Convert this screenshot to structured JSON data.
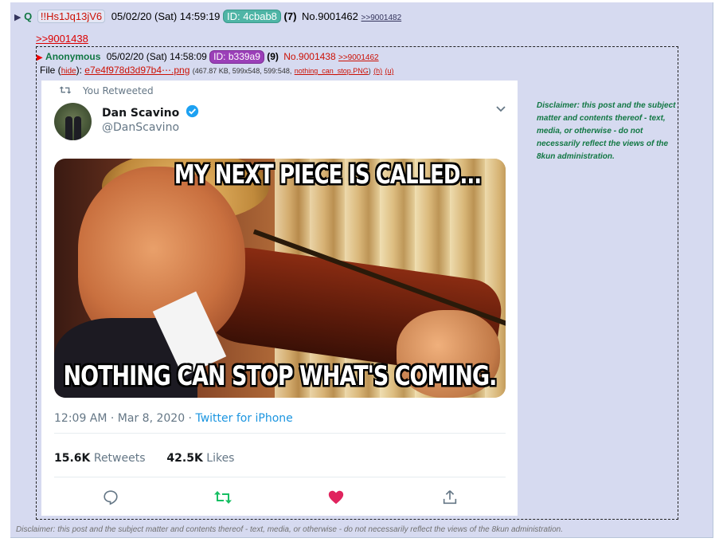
{
  "post": {
    "name": "Q",
    "tripcode": "!!Hs1Jq13jV6",
    "date": "05/02/20 (Sat) 14:59:19",
    "id_label": "ID: 4cbab8",
    "reply_count": "(7)",
    "post_number": "No.9001462",
    "backlink": ">>9001482",
    "quote_link": ">>9001438"
  },
  "quoted_post": {
    "name": "Anonymous",
    "date": "05/02/20 (Sat) 14:58:09",
    "id_label": "ID: b339a9",
    "reply_count": "(9)",
    "post_number": "No.9001438",
    "backlink": ">>9001462",
    "file_label": "File",
    "hide_link": "hide",
    "file_name": "e7e4f978d3d97b4⋯.png",
    "file_meta": "(467.87 KB, 599x548, 599:548,",
    "original_name": "nothing_can_stop.PNG",
    "h_link": "(h)",
    "u_link": "(u)",
    "file_meta_close": ")"
  },
  "tweet": {
    "retweet_label": "You Retweeted",
    "display_name": "Dan Scavino",
    "handle": "@DanScavino",
    "meme_top_text": "MY NEXT PIECE IS CALLED...",
    "meme_bottom_text": "NOTHING CAN STOP WHAT'S COMING.",
    "timestamp": "12:09 AM · Mar 8, 2020 · ",
    "source": "Twitter for iPhone",
    "retweets_count": "15.6K",
    "retweets_label": "Retweets",
    "likes_count": "42.5K",
    "likes_label": "Likes",
    "icons": [
      "retweet-icon",
      "verified-badge-icon",
      "chevron-down-icon",
      "reply-icon",
      "retweet-icon",
      "like-icon",
      "share-icon"
    ]
  },
  "disclaimer_side": "Disclaimer: this post and the subject matter and contents thereof - text, media, or otherwise - do not necessarily reflect the views of the 8kun administration.",
  "disclaimer_bottom": "Disclaimer: this post and the subject matter and contents thereof - text, media, or otherwise - do not necessarily reflect the views of the 8kun administration.",
  "colors": {
    "post_background": "#d6daf0",
    "name_green": "#117743",
    "link_red": "#cc1105",
    "id_teal": "#4fb5a6",
    "id_purple": "#9b3fb8",
    "twitter_blue": "#1b95e0",
    "retweet_green": "#17bf63",
    "like_red": "#e0245e"
  }
}
